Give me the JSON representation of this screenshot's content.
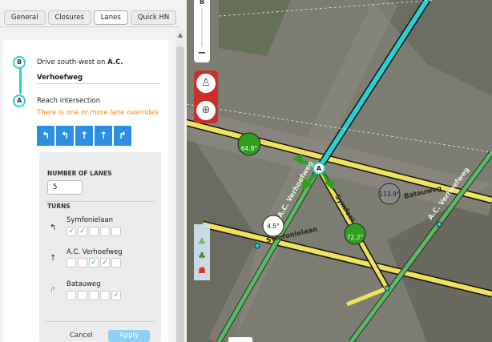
{
  "tabs": [
    {
      "label": "General"
    },
    {
      "label": "Closures"
    },
    {
      "label": "Lanes",
      "active": true
    },
    {
      "label": "Quick HN"
    }
  ],
  "segment": {
    "marker_b": "B",
    "marker_a": "A",
    "drive_prefix": "Drive south-west on ",
    "drive_street_1": "A.C.",
    "drive_street_2": "Verhoefweg",
    "reach": "Reach intersection",
    "override_note": "There is one or more lane overrides"
  },
  "lane_icons": [
    "↰",
    "↰",
    "↑",
    "↑",
    "↱"
  ],
  "lanes_panel": {
    "count_heading": "NUMBER OF LANES",
    "count_value": "5",
    "turns_heading": "TURNS",
    "turns": [
      {
        "name": "Symfonielaan",
        "icon": "↰",
        "checks": [
          true,
          true,
          false,
          false,
          false
        ]
      },
      {
        "name": "A.C. Verhoefweg",
        "icon": "↑",
        "checks": [
          false,
          false,
          true,
          true,
          false
        ]
      },
      {
        "name": "Batauweg",
        "icon": "↱",
        "icon_color": "#f08a1f",
        "checks": [
          false,
          false,
          false,
          false,
          true
        ]
      }
    ],
    "cancel_label": "Cancel",
    "apply_label": "Apply"
  },
  "map": {
    "zoom_level": "8",
    "zoom_minus": "−",
    "streets": [
      "A.C. Verhoefweg",
      "Symfonielaan",
      "Symfoni",
      "Batauweg",
      "A.C. Verhoefweg"
    ],
    "node_label": "A",
    "angles": [
      {
        "label": "64.8°",
        "color": "#2e9e1f"
      },
      {
        "label": "113.9°",
        "color": "#8a8a8a"
      },
      {
        "label": "4.5°",
        "color": "#ffffff"
      },
      {
        "label": "72.2°",
        "color": "#2e9e1f"
      }
    ],
    "colors": {
      "highlight": "#2ad0d0",
      "road_yellow": "#f0e25a",
      "road_green": "#5aba62",
      "accent_blue": "#2b8fe4"
    }
  }
}
